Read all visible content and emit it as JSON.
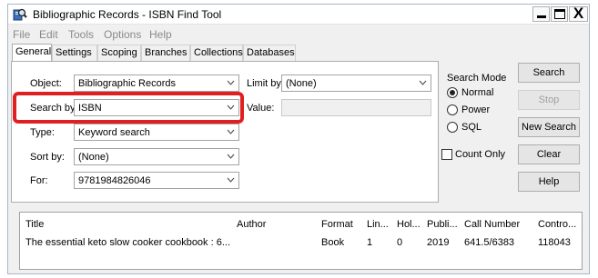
{
  "window": {
    "title": "Bibliographic Records - ISBN Find Tool",
    "controls": {
      "minimize": "_",
      "maximize": "□",
      "close": "X"
    }
  },
  "menu": [
    "File",
    "Edit",
    "Tools",
    "Options",
    "Help"
  ],
  "tabs": [
    "General",
    "Settings",
    "Scoping",
    "Branches",
    "Collections",
    "Databases"
  ],
  "active_tab": "General",
  "form": {
    "object_label": "Object:",
    "object_value": "Bibliographic Records",
    "limit_label": "Limit by:",
    "limit_value": "(None)",
    "search_by_label": "Search by:",
    "search_by_value": "ISBN",
    "value_label": "Value:",
    "value_text": "",
    "type_label": "Type:",
    "type_value": "Keyword search",
    "sort_label": "Sort by:",
    "sort_value": "(None)",
    "for_label": "For:",
    "for_value": "9781984826046"
  },
  "search_mode": {
    "title": "Search Mode",
    "options": [
      "Normal",
      "Power",
      "SQL"
    ],
    "selected": "Normal",
    "count_only_label": "Count Only",
    "count_only_checked": false
  },
  "buttons": {
    "search": "Search",
    "stop": "Stop",
    "new_search": "New Search",
    "clear": "Clear",
    "help": "Help"
  },
  "results": {
    "columns": [
      "Title",
      "Author",
      "Format",
      "Lin...",
      "Hol...",
      "Publi...",
      "Call Number",
      "Contro..."
    ],
    "rows": [
      [
        "The essential keto slow cooker cookbook : 6...",
        "",
        "Book",
        "1",
        "0",
        "2019",
        "641.5/6383",
        "118043"
      ]
    ]
  },
  "colors": {
    "highlight": "#e02020",
    "panel_bg": "#f0f0f0"
  },
  "icons": {
    "app": "search-book-icon",
    "dropdown": "chevron-down-icon"
  }
}
